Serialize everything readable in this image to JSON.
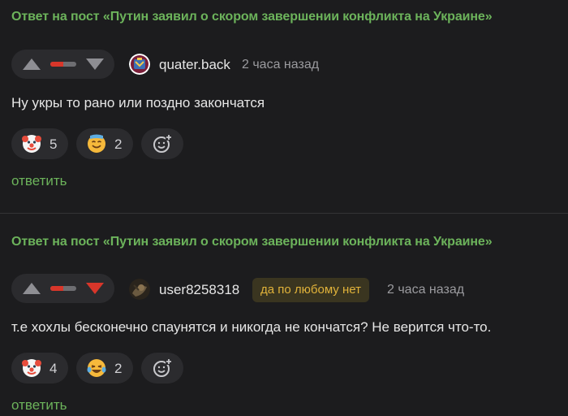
{
  "colors": {
    "background": "#1c1c1e",
    "link_green": "#6cb35b",
    "downvote_red": "#d8362a",
    "badge_text": "#e0b23a"
  },
  "comments": [
    {
      "post_link": "Ответ на пост «Путин заявил о скором завершении конфликта на Украине»",
      "rating_negative_fraction": 0.5,
      "downvote_active": false,
      "avatar_icon": "club-crest-avatar",
      "username": "quater.back",
      "badge": "",
      "time": "2 часа назад",
      "text": "Ну укры то рано или поздно закончатся",
      "reactions": [
        {
          "icon": "clown-face-emoji",
          "count": "5"
        },
        {
          "icon": "smiling-face-sweat-emoji",
          "count": "2"
        }
      ],
      "reply_label": "ответить"
    },
    {
      "post_link": "Ответ на пост «Путин заявил о скором завершении конфликта на Украине»",
      "rating_negative_fraction": 0.5,
      "downvote_active": true,
      "avatar_icon": "dark-photo-avatar",
      "username": "user8258318",
      "badge": "да по любому нет",
      "time": "2 часа назад",
      "text": "т.е хохлы бесконечно спаунятся и никогда не кончатся? Не верится что-то.",
      "reactions": [
        {
          "icon": "clown-face-emoji",
          "count": "4"
        },
        {
          "icon": "laughing-tears-emoji",
          "count": "2"
        }
      ],
      "reply_label": "ответить"
    }
  ]
}
